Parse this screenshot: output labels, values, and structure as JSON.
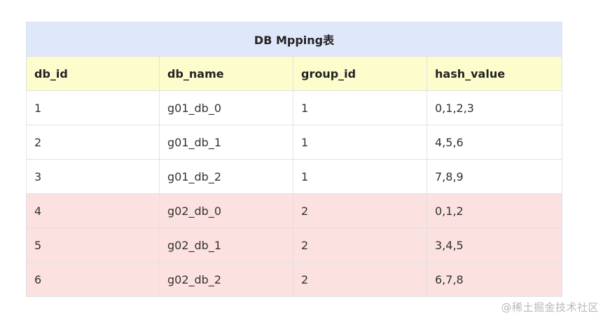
{
  "table": {
    "caption": "DB Mpping表",
    "columns": [
      "db_id",
      "db_name",
      "group_id",
      "hash_value"
    ],
    "rows": [
      {
        "db_id": "1",
        "db_name": "g01_db_0",
        "group_id": "1",
        "hash_value": "0,1,2,3",
        "highlight": false
      },
      {
        "db_id": "2",
        "db_name": "g01_db_1",
        "group_id": "1",
        "hash_value": "4,5,6",
        "highlight": false
      },
      {
        "db_id": "3",
        "db_name": "g01_db_2",
        "group_id": "1",
        "hash_value": "7,8,9",
        "highlight": false
      },
      {
        "db_id": "4",
        "db_name": "g02_db_0",
        "group_id": "2",
        "hash_value": "0,1,2",
        "highlight": true
      },
      {
        "db_id": "5",
        "db_name": "g02_db_1",
        "group_id": "2",
        "hash_value": "3,4,5",
        "highlight": true
      },
      {
        "db_id": "6",
        "db_name": "g02_db_2",
        "group_id": "2",
        "hash_value": "6,7,8",
        "highlight": true
      }
    ]
  },
  "colors": {
    "caption_bg": "#dfe8fb",
    "header_bg": "#fcfccd",
    "highlight_row_bg": "#fce1e1",
    "border": "#dfe2e5"
  },
  "watermark": "@稀土掘金技术社区"
}
